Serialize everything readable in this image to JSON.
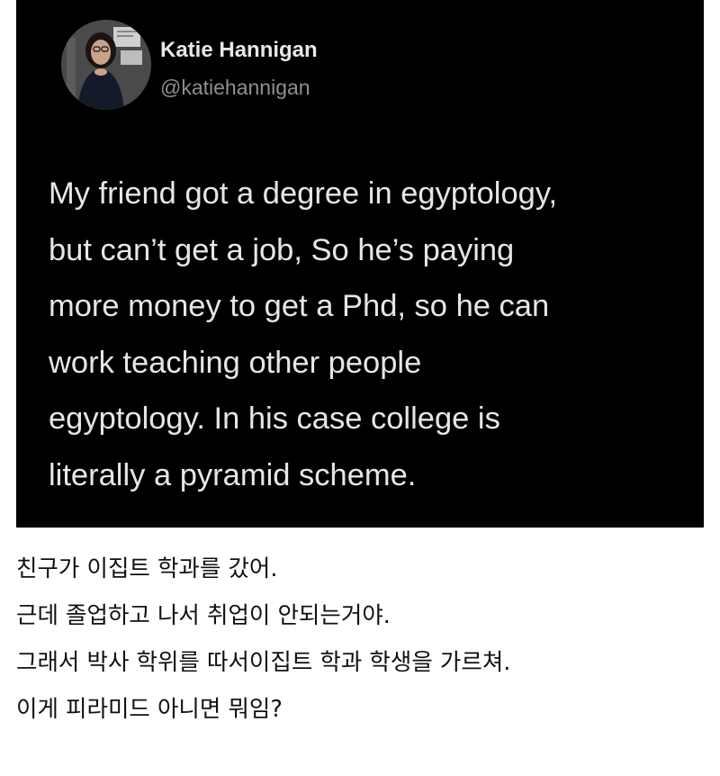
{
  "tweet": {
    "author_name": "Katie Hannigan",
    "author_handle": "@katiehannigan",
    "lines": [
      "My friend got a degree in egyptology,",
      "but can’t get a job, So he’s paying",
      "more money to get a Phd, so he can",
      "work teaching other people",
      "egyptology.  In his case college is",
      "literally a pyramid scheme."
    ],
    "background_color": "#000000",
    "text_color": "#e6e6e6",
    "handle_color": "#8f8f8f"
  },
  "caption": {
    "lines": [
      "친구가 이집트 학과를 갔어.",
      "근데 졸업하고 나서 취업이 안되는거야.",
      "그래서 박사 학위를 따서이집트 학과 학생을 가르쳐.",
      "이게 피라미드 아니면 뭐임?"
    ],
    "text_color": "#111111"
  }
}
